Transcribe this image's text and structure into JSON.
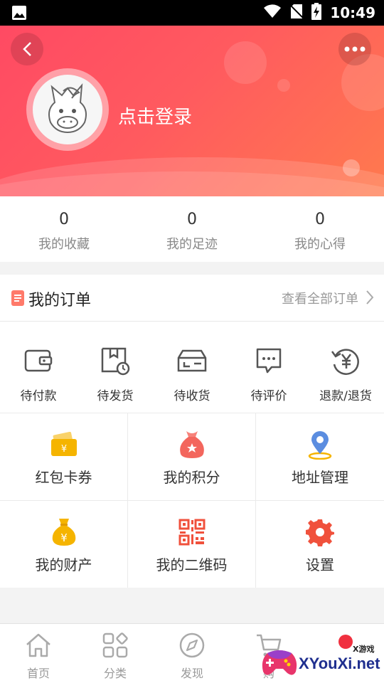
{
  "status_bar": {
    "time": "10:49"
  },
  "header": {
    "login_text": "点击登录"
  },
  "stats": [
    {
      "value": "0",
      "label": "我的收藏"
    },
    {
      "value": "0",
      "label": "我的足迹"
    },
    {
      "value": "0",
      "label": "我的心得"
    }
  ],
  "orders": {
    "title": "我的订单",
    "view_all": "查看全部订单",
    "items": [
      {
        "label": "待付款",
        "icon": "wallet-icon"
      },
      {
        "label": "待发货",
        "icon": "package-clock-icon"
      },
      {
        "label": "待收货",
        "icon": "delivery-card-icon"
      },
      {
        "label": "待评价",
        "icon": "comment-icon"
      },
      {
        "label": "退款/退货",
        "icon": "refund-icon"
      }
    ]
  },
  "grid": [
    {
      "label": "红包卡券",
      "icon": "coupon-icon"
    },
    {
      "label": "我的积分",
      "icon": "points-bag-icon"
    },
    {
      "label": "地址管理",
      "icon": "location-pin-icon"
    },
    {
      "label": "我的财产",
      "icon": "money-bag-icon"
    },
    {
      "label": "我的二维码",
      "icon": "qr-code-icon"
    },
    {
      "label": "设置",
      "icon": "settings-gear-icon"
    }
  ],
  "bottom_nav": [
    {
      "label": "首页",
      "icon": "home-icon"
    },
    {
      "label": "分类",
      "icon": "category-icon"
    },
    {
      "label": "发现",
      "icon": "compass-icon"
    },
    {
      "label": "购",
      "icon": "cart-icon"
    }
  ],
  "watermark": {
    "small": "X游戏",
    "text": "XYouXi.net"
  },
  "colors": {
    "brand": "#ff5a5f",
    "gold": "#f5b400",
    "blue_pin": "#5b8de0",
    "red_accent": "#f0513c"
  }
}
